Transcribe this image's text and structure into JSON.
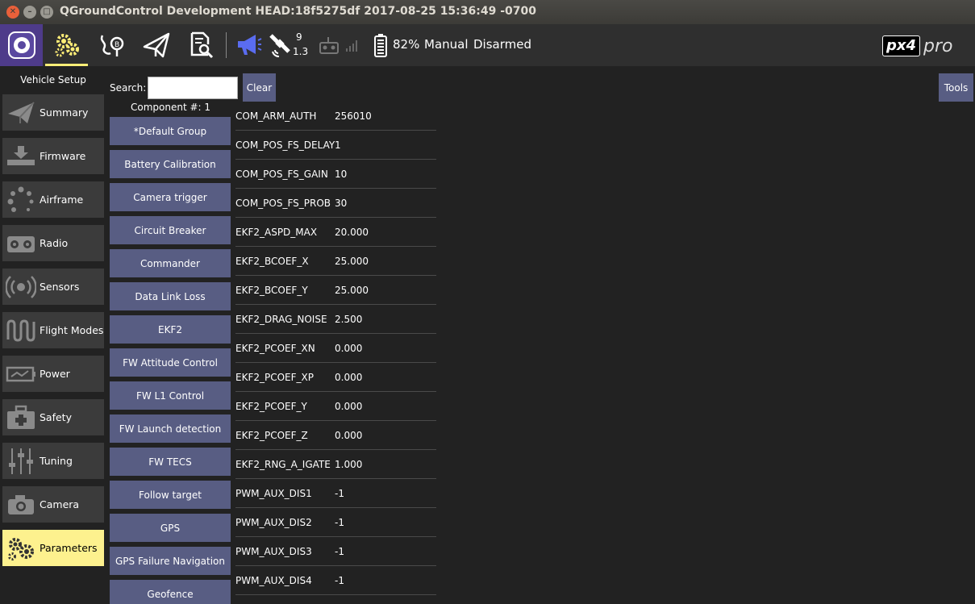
{
  "window": {
    "title": "QGroundControl Development HEAD:18f5275df 2017-08-25 15:36:49 -0700"
  },
  "toolbar": {
    "icons": [
      "qgc-logo-icon",
      "vehicle-setup-icon",
      "plan-icon",
      "fly-icon",
      "analyze-icon",
      "messages-icon",
      "gps-icon",
      "rc-icon",
      "rssi-icon",
      "battery-icon"
    ],
    "gps_count": "9",
    "gps_hdop": "1.3",
    "battery": "82%",
    "flight_mode": "Manual",
    "arm_state": "Disarmed",
    "brand_logo": "px4",
    "brand_suffix": "pro",
    "accent_color": "#ffee77",
    "message_icon_color": "#5a6cf0"
  },
  "sidebar": {
    "title": "Vehicle Setup",
    "items": [
      {
        "label": "Summary",
        "icon": "summary-icon"
      },
      {
        "label": "Firmware",
        "icon": "firmware-icon"
      },
      {
        "label": "Airframe",
        "icon": "airframe-icon"
      },
      {
        "label": "Radio",
        "icon": "radio-icon"
      },
      {
        "label": "Sensors",
        "icon": "sensors-icon"
      },
      {
        "label": "Flight Modes",
        "icon": "flight-modes-icon"
      },
      {
        "label": "Power",
        "icon": "power-icon"
      },
      {
        "label": "Safety",
        "icon": "safety-icon"
      },
      {
        "label": "Tuning",
        "icon": "tuning-icon"
      },
      {
        "label": "Camera",
        "icon": "camera-icon"
      },
      {
        "label": "Parameters",
        "icon": "parameters-icon",
        "active": true
      }
    ]
  },
  "params": {
    "search_label": "Search:",
    "search_value": "",
    "clear_label": "Clear",
    "tools_label": "Tools",
    "component_label": "Component #: 1",
    "groups": [
      "*Default Group",
      "Battery Calibration",
      "Camera trigger",
      "Circuit Breaker",
      "Commander",
      "Data Link Loss",
      "EKF2",
      "FW Attitude Control",
      "FW L1 Control",
      "FW Launch detection",
      "FW TECS",
      "Follow target",
      "GPS",
      "GPS Failure Navigation",
      "Geofence"
    ],
    "rows": [
      {
        "name": "COM_ARM_AUTH",
        "value": "256010"
      },
      {
        "name": "COM_POS_FS_DELAY",
        "value": "1"
      },
      {
        "name": "COM_POS_FS_GAIN",
        "value": "10"
      },
      {
        "name": "COM_POS_FS_PROB",
        "value": "30"
      },
      {
        "name": "EKF2_ASPD_MAX",
        "value": "20.000"
      },
      {
        "name": "EKF2_BCOEF_X",
        "value": "25.000"
      },
      {
        "name": "EKF2_BCOEF_Y",
        "value": "25.000"
      },
      {
        "name": "EKF2_DRAG_NOISE",
        "value": "2.500"
      },
      {
        "name": "EKF2_PCOEF_XN",
        "value": "0.000"
      },
      {
        "name": "EKF2_PCOEF_XP",
        "value": "0.000"
      },
      {
        "name": "EKF2_PCOEF_Y",
        "value": "0.000"
      },
      {
        "name": "EKF2_PCOEF_Z",
        "value": "0.000"
      },
      {
        "name": "EKF2_RNG_A_IGATE",
        "value": "1.000"
      },
      {
        "name": "PWM_AUX_DIS1",
        "value": "-1"
      },
      {
        "name": "PWM_AUX_DIS2",
        "value": "-1"
      },
      {
        "name": "PWM_AUX_DIS3",
        "value": "-1"
      },
      {
        "name": "PWM_AUX_DIS4",
        "value": "-1"
      }
    ]
  }
}
